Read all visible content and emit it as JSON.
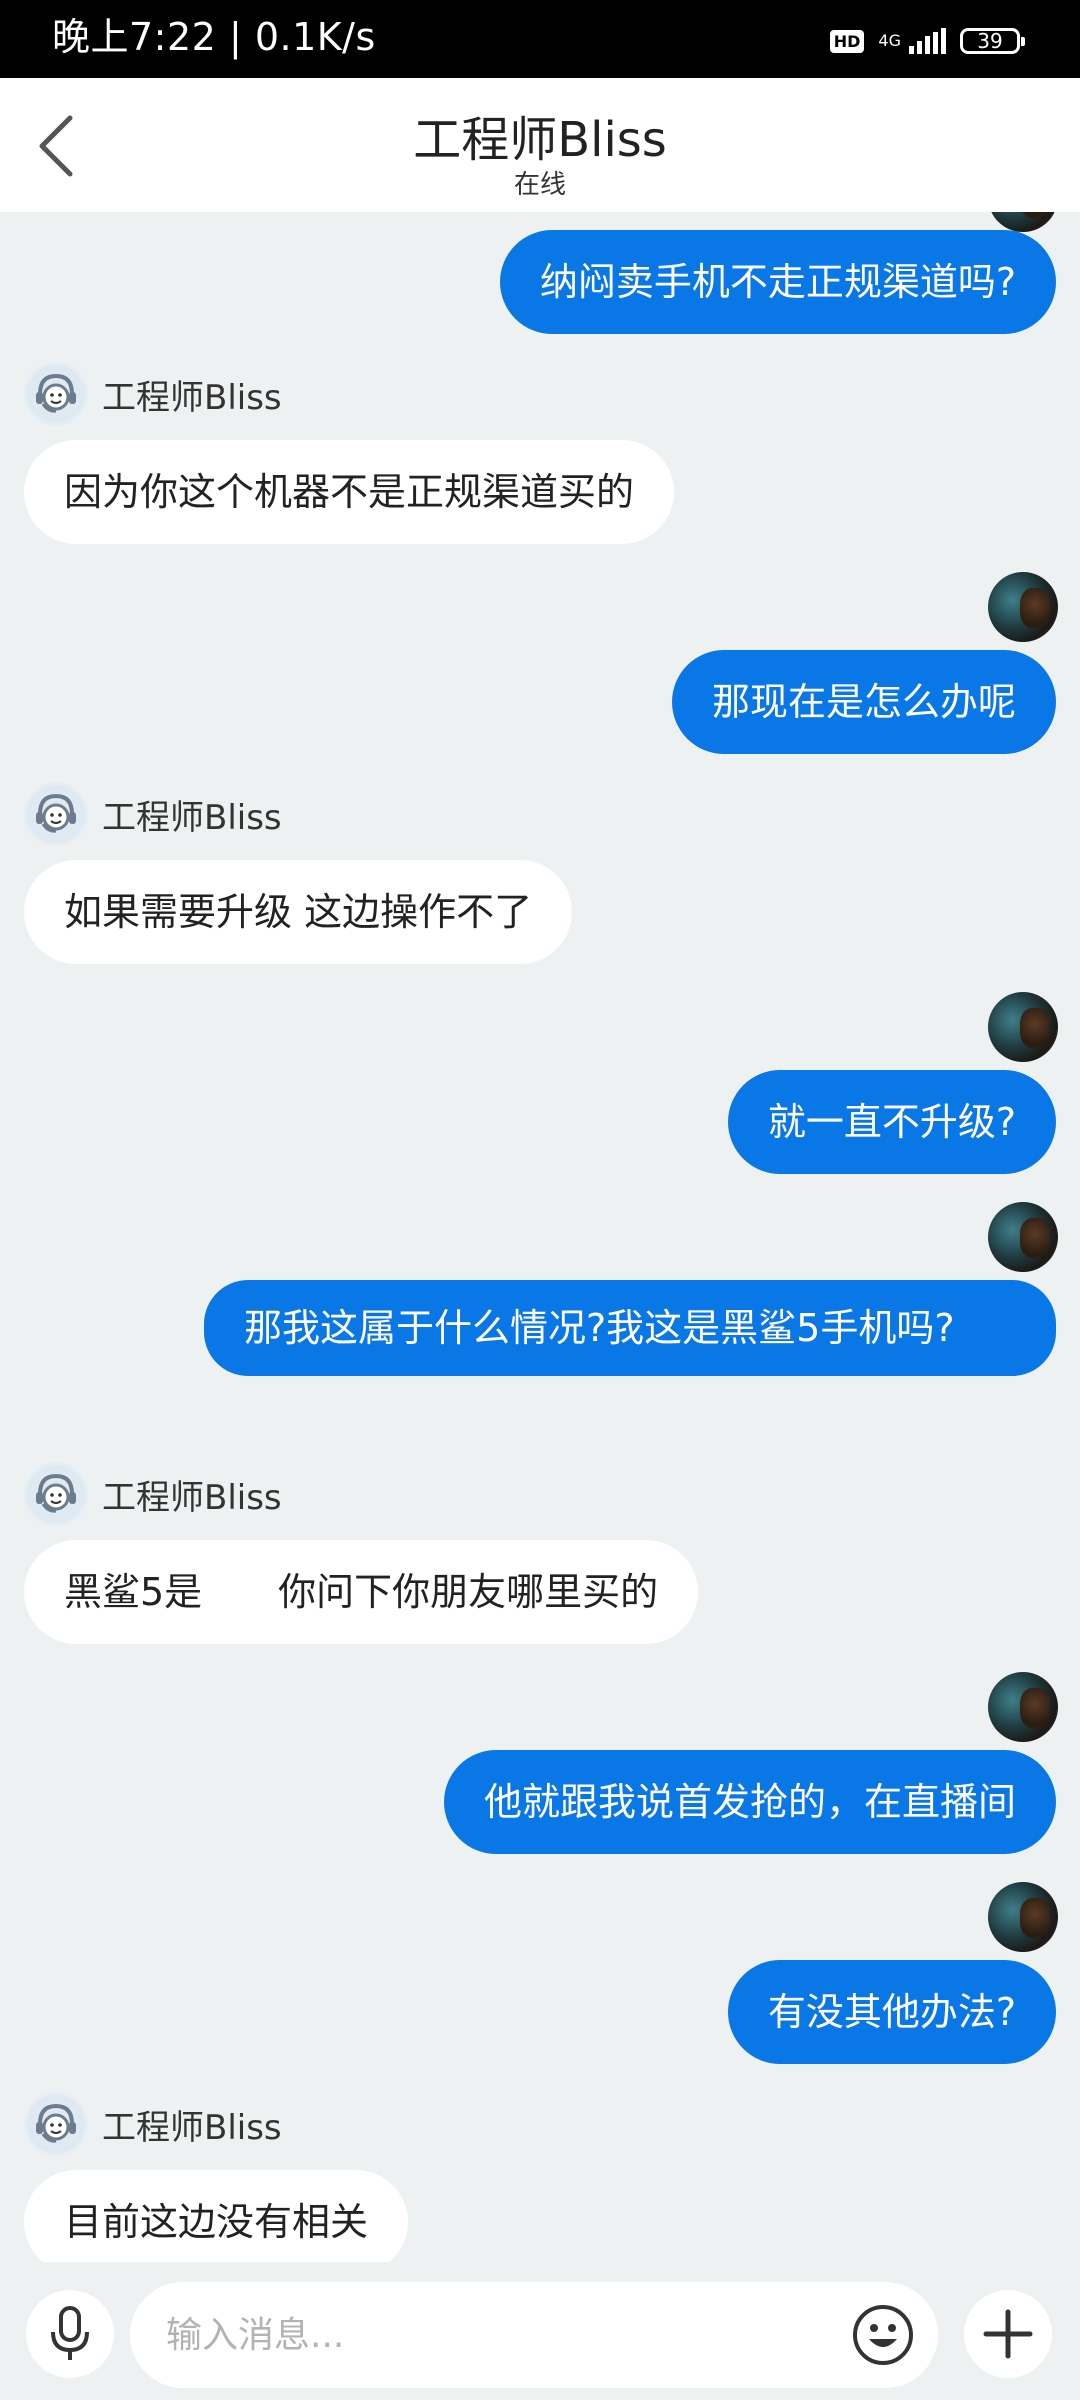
{
  "status_bar": {
    "time": "晚上7:22",
    "speed": "0.1K/s",
    "hd": "HD",
    "network": "4G",
    "battery": "39"
  },
  "header": {
    "title": "工程师Bliss",
    "subtitle": "在线",
    "back_icon": "chevron-left-icon"
  },
  "messages": [
    {
      "side": "out",
      "text": "纳闷卖手机不走正规渠道吗?"
    },
    {
      "side": "in",
      "sender": "工程师Bliss",
      "text": "因为你这个机器不是正规渠道买的"
    },
    {
      "side": "out",
      "text": "那现在是怎么办呢"
    },
    {
      "side": "in",
      "sender": "工程师Bliss",
      "text": "如果需要升级 这边操作不了"
    },
    {
      "side": "out",
      "text": "就一直不升级?"
    },
    {
      "side": "out",
      "text": "那我这属于什么情况?我这是黑鲨5手机吗?"
    },
    {
      "side": "in",
      "sender": "工程师Bliss",
      "text": "黑鲨5是　　你问下你朋友哪里买的"
    },
    {
      "side": "out",
      "text": "他就跟我说首发抢的，在直播间"
    },
    {
      "side": "out",
      "text": "有没其他办法?"
    },
    {
      "side": "in",
      "sender": "工程师Bliss",
      "text": "目前这边没有相关"
    }
  ],
  "input_bar": {
    "placeholder": "输入消息...",
    "mic_icon": "microphone-icon",
    "emoji_icon": "smiley-icon",
    "plus_icon": "plus-icon"
  },
  "colors": {
    "outgoing_bubble": "#0a77e6",
    "incoming_bubble": "#ffffff",
    "background": "#eef1f1"
  }
}
